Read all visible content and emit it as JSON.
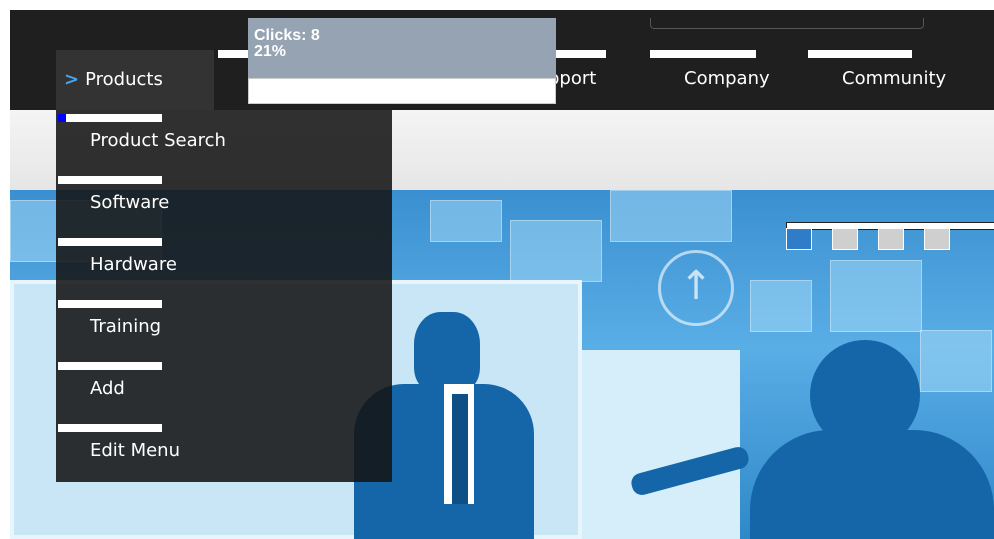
{
  "nav": {
    "items": [
      {
        "label": "Products",
        "active": true,
        "heat_fraction": 0.25
      },
      {
        "label": "pport",
        "heat_fraction": 0
      },
      {
        "label": "Company",
        "heat_fraction": 0
      },
      {
        "label": "Community",
        "heat_fraction": 0
      }
    ]
  },
  "tooltip": {
    "clicks": "Clicks: 8",
    "percent": "21%"
  },
  "dropdown": {
    "items": [
      {
        "label": "Product Search",
        "heat_fraction": 0.08
      },
      {
        "label": "Software",
        "heat_fraction": 0
      },
      {
        "label": "Hardware",
        "heat_fraction": 0
      },
      {
        "label": "Training",
        "heat_fraction": 0
      },
      {
        "label": "Add",
        "heat_fraction": 0
      },
      {
        "label": "Edit Menu",
        "heat_fraction": 0
      }
    ]
  },
  "slider": {
    "count": 4,
    "active_index": 0
  },
  "colors": {
    "accent": "#4aa3e8",
    "heat": "#0000ff",
    "topbar": "#1f1f1f",
    "tooltip": "#95a3b3"
  },
  "icons": [
    "chevron-right-icon",
    "up-arrow-circle-icon"
  ]
}
